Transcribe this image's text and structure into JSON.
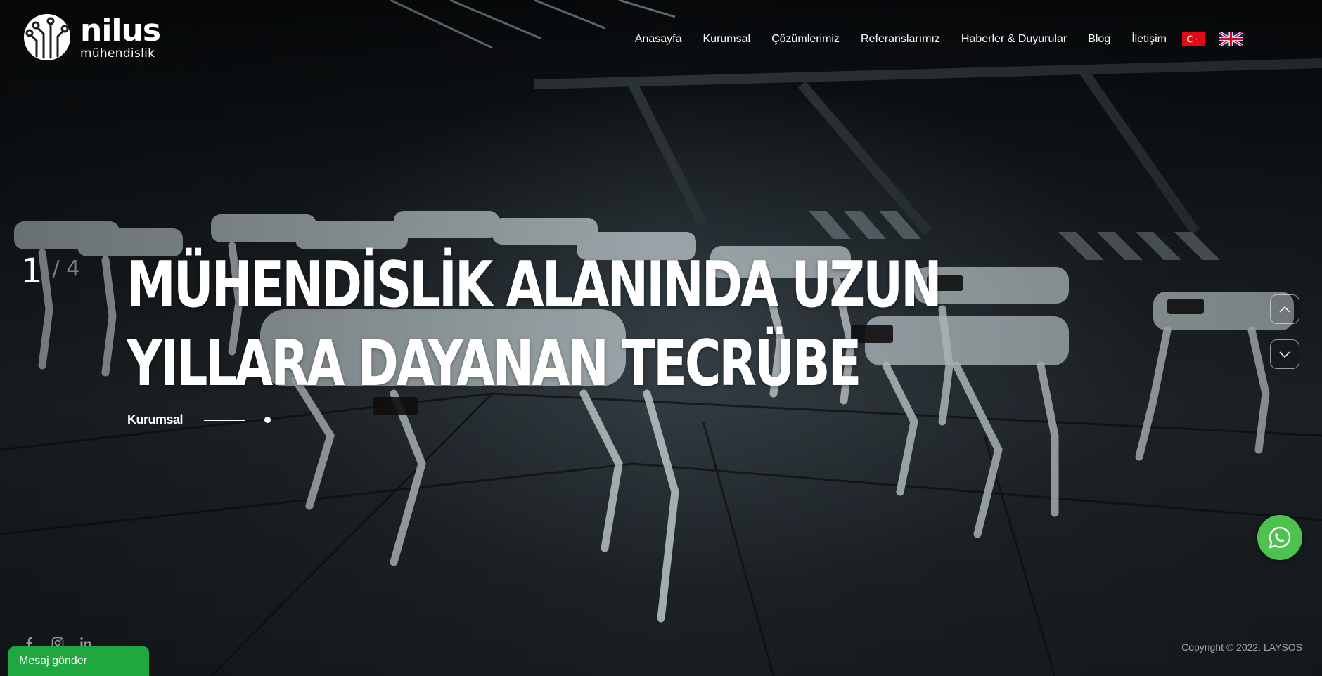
{
  "brand": {
    "name": "nilus",
    "tagline": "mühendislik"
  },
  "nav": {
    "items": [
      {
        "label": "Anasayfa"
      },
      {
        "label": "Kurumsal"
      },
      {
        "label": "Çözümlerimiz"
      },
      {
        "label": "Referanslarımız"
      },
      {
        "label": "Haberler & Duyurular"
      },
      {
        "label": "Blog"
      },
      {
        "label": "İletişim"
      }
    ],
    "languages": [
      {
        "code": "tr",
        "icon": "turkey-flag-icon"
      },
      {
        "code": "en",
        "icon": "uk-flag-icon"
      }
    ]
  },
  "slider": {
    "current": "1",
    "separator": "/ 4",
    "headline_line1": "MÜHENDİSLİK ALANINDA UZUN",
    "headline_line2": "YILLARA DAYANAN TECRÜBE",
    "link_label": "Kurumsal",
    "prev_icon": "chevron-up-icon",
    "next_icon": "chevron-down-icon"
  },
  "social": [
    "facebook-icon",
    "instagram-icon",
    "linkedin-icon"
  ],
  "chat": {
    "label": "Mesaj gönder",
    "accent": "#1fa83f"
  },
  "whatsapp": {
    "icon": "whatsapp-icon",
    "color": "#4ec24e"
  },
  "footer": {
    "copyright": "Copyright © 2022. LAYSOS"
  }
}
